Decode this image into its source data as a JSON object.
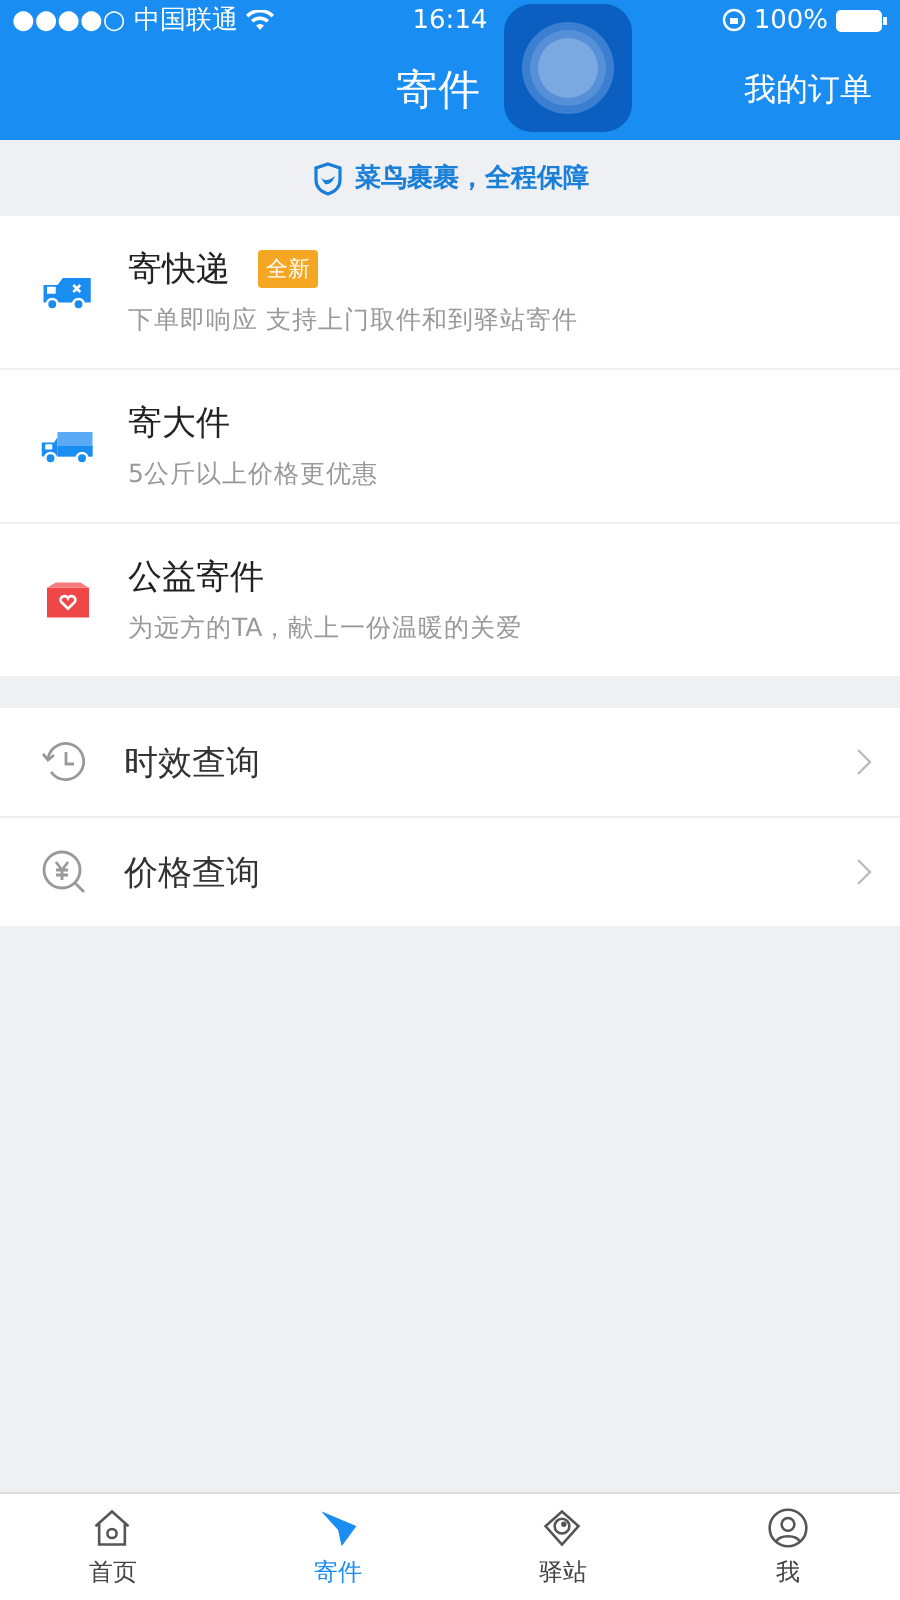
{
  "status_bar": {
    "carrier": "●●●●○ 中国联通",
    "time": "16:14",
    "battery": "100%"
  },
  "nav": {
    "title": "寄件",
    "action": "我的订单"
  },
  "banner": {
    "text": "菜鸟裹裹，全程保障"
  },
  "services": [
    {
      "kind": "express",
      "title": "寄快递",
      "badge": "全新",
      "subtitle": "下单即响应 支持上门取件和到驿站寄件"
    },
    {
      "kind": "large",
      "title": "寄大件",
      "subtitle": "5公斤以上价格更优惠"
    },
    {
      "kind": "charity",
      "title": "公益寄件",
      "subtitle": "为远方的TA，献上一份温暖的关爱"
    }
  ],
  "queries": [
    {
      "kind": "time",
      "label": "时效查询"
    },
    {
      "kind": "price",
      "label": "价格查询"
    }
  ],
  "tab_bar": [
    {
      "kind": "home",
      "label": "首页",
      "selected": false
    },
    {
      "kind": "send",
      "label": "寄件",
      "selected": true
    },
    {
      "kind": "station",
      "label": "驿站",
      "selected": false
    },
    {
      "kind": "me",
      "label": "我",
      "selected": false
    }
  ]
}
